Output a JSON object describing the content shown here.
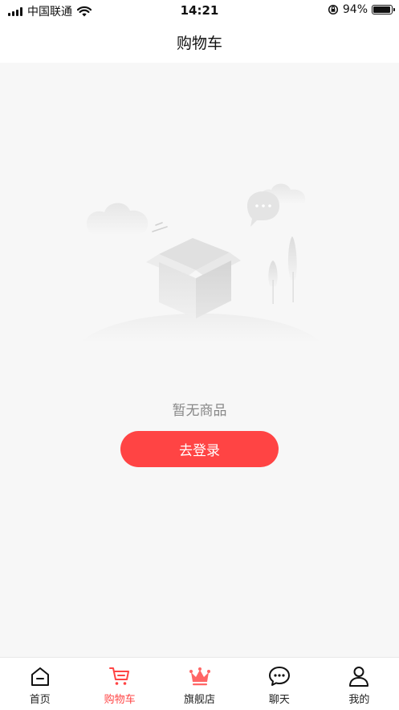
{
  "status_bar": {
    "carrier": "中国联通",
    "time": "14:21",
    "battery_percent": "94%",
    "battery_level": 0.94,
    "icons": [
      "signal-icon",
      "wifi-icon",
      "orientation-lock-icon",
      "battery-icon"
    ]
  },
  "header": {
    "title": "购物车"
  },
  "main": {
    "empty_message": "暂无商品",
    "login_button": "去登录",
    "illustration": "empty-box-illustration"
  },
  "tab_bar": {
    "active_index": 1,
    "active_color": "#ff4444",
    "tabs": [
      {
        "label": "首页",
        "icon": "home-icon"
      },
      {
        "label": "购物车",
        "icon": "cart-icon"
      },
      {
        "label": "旗舰店",
        "icon": "crown-icon"
      },
      {
        "label": "聊天",
        "icon": "chat-icon"
      },
      {
        "label": "我的",
        "icon": "user-icon"
      }
    ]
  },
  "colors": {
    "accent": "#ff4444",
    "background": "#f7f7f7",
    "text_muted": "#888888"
  }
}
